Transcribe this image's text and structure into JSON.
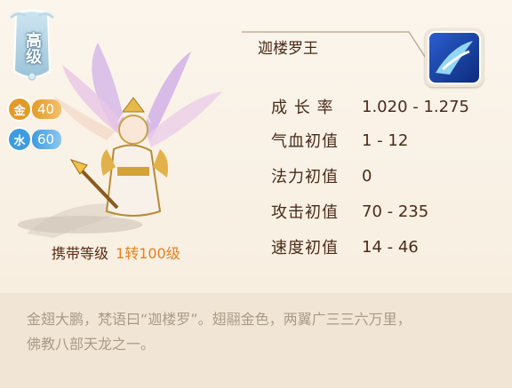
{
  "badge": {
    "tier": "高级"
  },
  "elements": [
    {
      "icon": "金",
      "value": "40",
      "color": "#e49a27"
    },
    {
      "icon": "水",
      "value": "60",
      "color": "#3f9be0"
    }
  ],
  "pet": {
    "name": "迦楼罗王",
    "skill_icon": "wind-blade-skill-icon"
  },
  "stats": [
    {
      "label": "成 长 率",
      "value": "1.020 - 1.275"
    },
    {
      "label": "气血初值",
      "value": "1 - 12"
    },
    {
      "label": "法力初值",
      "value": "0"
    },
    {
      "label": "攻击初值",
      "value": "70 - 235"
    },
    {
      "label": "速度初值",
      "value": "14 - 46"
    }
  ],
  "carry": {
    "label": "携带等级",
    "value": "1转100级"
  },
  "description": {
    "line1": "金翅大鹏，梵语曰“迦楼罗”。翅翮金色，两翼广三三六万里，",
    "line2": "佛教八部天龙之一。"
  },
  "colors": {
    "text_dark": "#4b2b1a",
    "accent_orange": "#e6801f",
    "desc_gray": "#a99a88",
    "panel_bg": "#f8efe1"
  }
}
